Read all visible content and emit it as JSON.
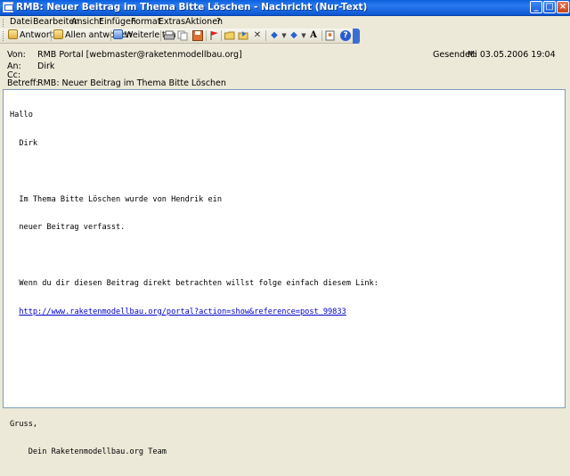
{
  "window": {
    "title": "RMB: Neuer Beitrag im Thema Bitte Löschen - Nachricht (Nur-Text)",
    "min_glyph": "_",
    "max_glyph": "□",
    "close_glyph": "×"
  },
  "menu": [
    "Datei",
    "Bearbeiten",
    "Ansicht",
    "Einfügen",
    "Format",
    "Extras",
    "Aktionen",
    "?"
  ],
  "toolbar": {
    "reply": "Antworten",
    "reply_all": "Allen antworten",
    "forward": "Weiterleiten",
    "icons": [
      "print-icon",
      "copy-icon",
      "save-icon",
      "flag-icon",
      "open-folder-icon",
      "move-icon",
      "delete-icon",
      "previous-icon",
      "next-icon",
      "font-size-icon",
      "address-book-icon",
      "help-icon"
    ],
    "font_size_glyph": "A",
    "help_glyph": "?"
  },
  "header": {
    "from_label": "Von:",
    "from_value": "RMB Portal [webmaster@raketenmodellbau.org]",
    "to_label": "An:",
    "to_value": "Dirk",
    "cc_label": "Cc:",
    "cc_value": "",
    "subject_label": "Betreff:",
    "subject_value": "RMB: Neuer Beitrag im Thema Bitte Löschen",
    "sent_label": "Gesendet:",
    "sent_value": "Mi 03.05.2006 19:04"
  },
  "body": {
    "line1": "Hallo",
    "line2": "  Dirk",
    "line3": "",
    "line4": "  Im Thema Bitte Löschen wurde von Hendrik ein",
    "line5": "  neuer Beitrag verfasst.",
    "line6": "",
    "line7": "  Wenn du dir diesen Beitrag direkt betrachten willst folge einfach diesem Link:",
    "link_indent": "  ",
    "link": "http://www.raketenmodellbau.org/portal?action=show&reference=post_99833",
    "line9": "",
    "line10": "",
    "line11": "",
    "line12": "Gruss,",
    "line13": "    Dein Raketenmodellbau.org Team"
  }
}
